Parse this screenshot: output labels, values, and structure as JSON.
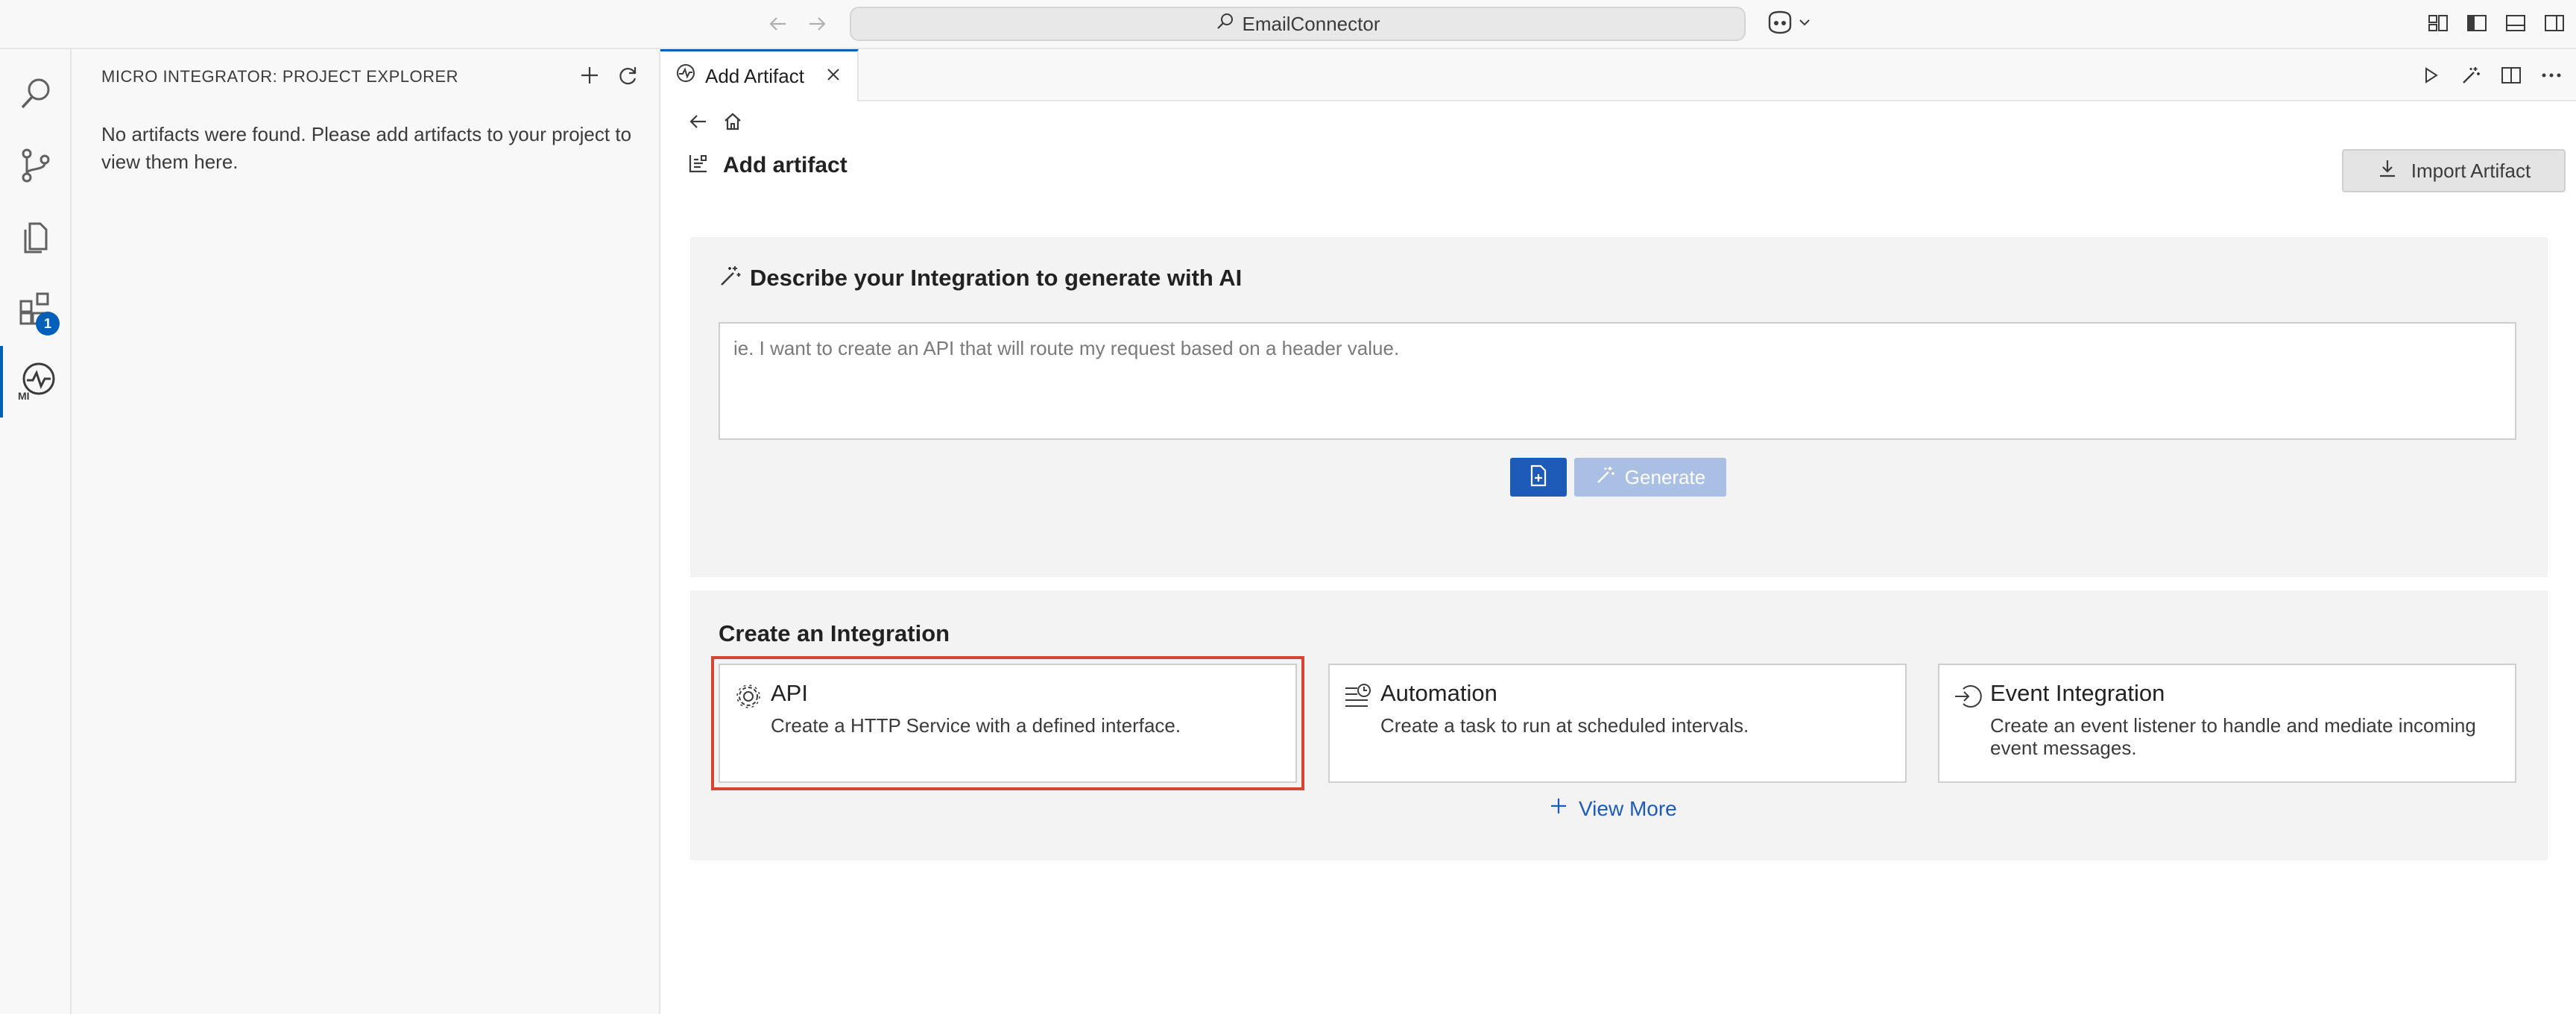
{
  "titlebar": {
    "search_text": "EmailConnector"
  },
  "activity_bar": {
    "extensions_badge": "1"
  },
  "sidebar": {
    "title": "MICRO INTEGRATOR: PROJECT EXPLORER",
    "empty_message": "No artifacts were found. Please add artifacts to your project to view them here."
  },
  "editor": {
    "tab_label": "Add Artifact",
    "page_title": "Add artifact",
    "import_button": "Import Artifact"
  },
  "ai": {
    "heading": "Describe your Integration to generate with AI",
    "placeholder": "ie. I want to create an API that will route my request based on a header value.",
    "generate_label": "Generate"
  },
  "integration": {
    "heading": "Create an Integration",
    "cards": [
      {
        "title": "API",
        "desc": "Create a HTTP Service with a defined interface.",
        "icon": "gear-icon"
      },
      {
        "title": "Automation",
        "desc": "Create a task to run at scheduled intervals.",
        "icon": "schedule-icon"
      },
      {
        "title": "Event Integration",
        "desc": "Create an event listener to handle and mediate incoming event messages.",
        "icon": "event-icon"
      }
    ],
    "view_more": "View More"
  },
  "colors": {
    "accent": "#005fb8",
    "button_primary": "#1e5bb8",
    "button_disabled": "#a9c0e4",
    "highlight_outline": "#d64531"
  }
}
